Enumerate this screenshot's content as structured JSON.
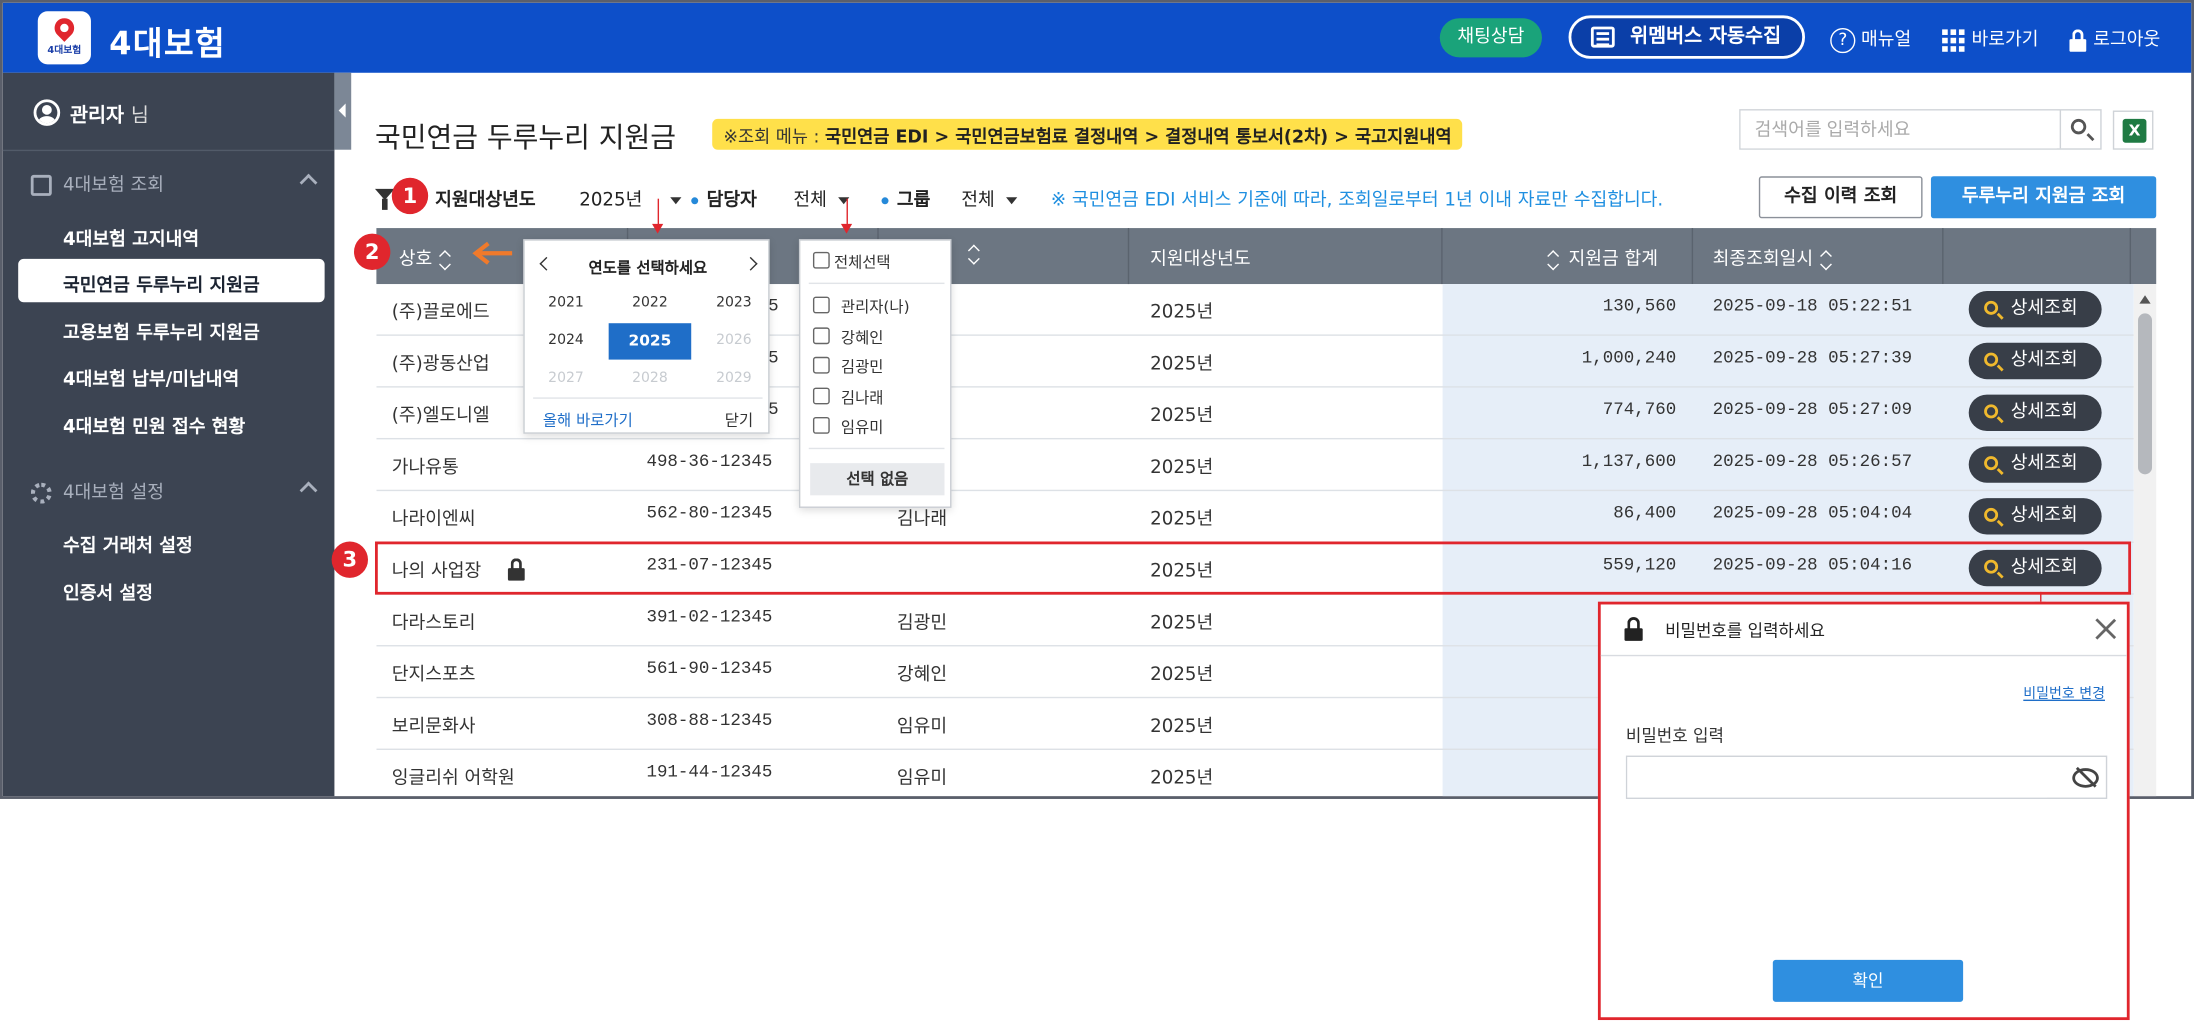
{
  "header": {
    "logo_text": "4대보험",
    "app_title": "4대보험",
    "chat_label": "채팅상담",
    "wemembers_label": "위멤버스 자동수집",
    "manual_label": "매뉴얼",
    "shortcut_label": "바로가기",
    "logout_label": "로그아웃"
  },
  "sidebar": {
    "user_name": "관리자",
    "user_suffix": "님",
    "sections": [
      {
        "title": "4대보험 조회",
        "items": [
          "4대보험 고지내역",
          "국민연금 두루누리 지원금",
          "고용보험 두루누리 지원금",
          "4대보험 납부/미납내역",
          "4대보험 민원 접수 현황"
        ]
      },
      {
        "title": "4대보험 설정",
        "items": [
          "수집 거래처 설정",
          "인증서 설정"
        ]
      }
    ],
    "active_item": "국민연금 두루누리 지원금"
  },
  "main": {
    "page_title": "국민연금 두루누리 지원금",
    "crumb_prefix": "※조회 메뉴 : ",
    "crumb_path": "국민연금 EDI > 국민연금보험료 결정내역 > 결정내역 통보서(2차) > 국고지원내역",
    "search_placeholder": "검색어를 입력하세요",
    "excel_icon_text": "X"
  },
  "filters": {
    "year_label": "지원대상년도",
    "year_value": "2025년",
    "manager_label": "담당자",
    "manager_value": "전체",
    "group_label": "그룹",
    "group_value": "전체",
    "notice": "※ 국민연금 EDI 서비스 기준에 따라, 조회일로부터 1년 이내 자료만 수집합니다.",
    "history_button": "수집 이력 조회",
    "subsidy_button": "두루누리 지원금 조회"
  },
  "badges": [
    "1",
    "2",
    "3"
  ],
  "table": {
    "columns": [
      "상호",
      "지원대상년도",
      "지원금 합계",
      "최종조회일시"
    ],
    "detail_label": "상세조회",
    "rows": [
      {
        "name": "(주)끌로에드",
        "bizno": "",
        "manager": "",
        "year": "2025년",
        "amount": "130,560",
        "date": "2025-09-18 05:22:51"
      },
      {
        "name": "(주)광동산업",
        "bizno": "",
        "manager": "",
        "year": "2025년",
        "amount": "1,000,240",
        "date": "2025-09-28 05:27:39"
      },
      {
        "name": "(주)엘도니엘",
        "bizno": "",
        "manager": "",
        "year": "2025년",
        "amount": "774,760",
        "date": "2025-09-28 05:27:09"
      },
      {
        "name": "가나유통",
        "bizno": "498-36-12345",
        "manager": "",
        "year": "2025년",
        "amount": "1,137,600",
        "date": "2025-09-28 05:26:57"
      },
      {
        "name": "나라이엔씨",
        "bizno": "562-80-12345",
        "manager": "김나래",
        "year": "2025년",
        "amount": "86,400",
        "date": "2025-09-28 05:04:04"
      },
      {
        "name": "나의 사업장",
        "bizno": "231-07-12345",
        "manager": "",
        "year": "2025년",
        "amount": "559,120",
        "date": "2025-09-28 05:04:16"
      },
      {
        "name": "다라스토리",
        "bizno": "391-02-12345",
        "manager": "김광민",
        "year": "2025년",
        "amount": "",
        "date": ""
      },
      {
        "name": "단지스포츠",
        "bizno": "561-90-12345",
        "manager": "강혜인",
        "year": "2025년",
        "amount": "",
        "date": ""
      },
      {
        "name": "보리문화사",
        "bizno": "308-88-12345",
        "manager": "임유미",
        "year": "2025년",
        "amount": "",
        "date": ""
      },
      {
        "name": "잉글리쉬 어학원",
        "bizno": "191-44-12345",
        "manager": "임유미",
        "year": "2025년",
        "amount": "",
        "date": ""
      }
    ],
    "bizno_partial_suffix": "5"
  },
  "year_picker": {
    "title": "연도를 선택하세요",
    "years": [
      {
        "label": "2021",
        "state": "normal"
      },
      {
        "label": "2022",
        "state": "normal"
      },
      {
        "label": "2023",
        "state": "normal"
      },
      {
        "label": "2024",
        "state": "normal"
      },
      {
        "label": "2025",
        "state": "selected"
      },
      {
        "label": "2026",
        "state": "disabled"
      },
      {
        "label": "2027",
        "state": "disabled"
      },
      {
        "label": "2028",
        "state": "disabled"
      },
      {
        "label": "2029",
        "state": "disabled"
      }
    ],
    "this_year_link": "올해 바로가기",
    "close_label": "닫기"
  },
  "manager_dropdown": {
    "select_all": "전체선택",
    "options": [
      "관리자(나)",
      "강혜인",
      "김광민",
      "김나래",
      "임유미"
    ],
    "none_button": "선택 없음"
  },
  "password_modal": {
    "title": "비밀번호를 입력하세요",
    "change_link": "비밀번호 변경",
    "input_label": "비밀번호 입력",
    "confirm_button": "확인"
  },
  "colors": {
    "topbar": "#0d4fc9",
    "sidebar": "#3c4452",
    "highlight": "#e0262d",
    "accent": "#2f8fe0",
    "crumb": "#ffe04a"
  }
}
